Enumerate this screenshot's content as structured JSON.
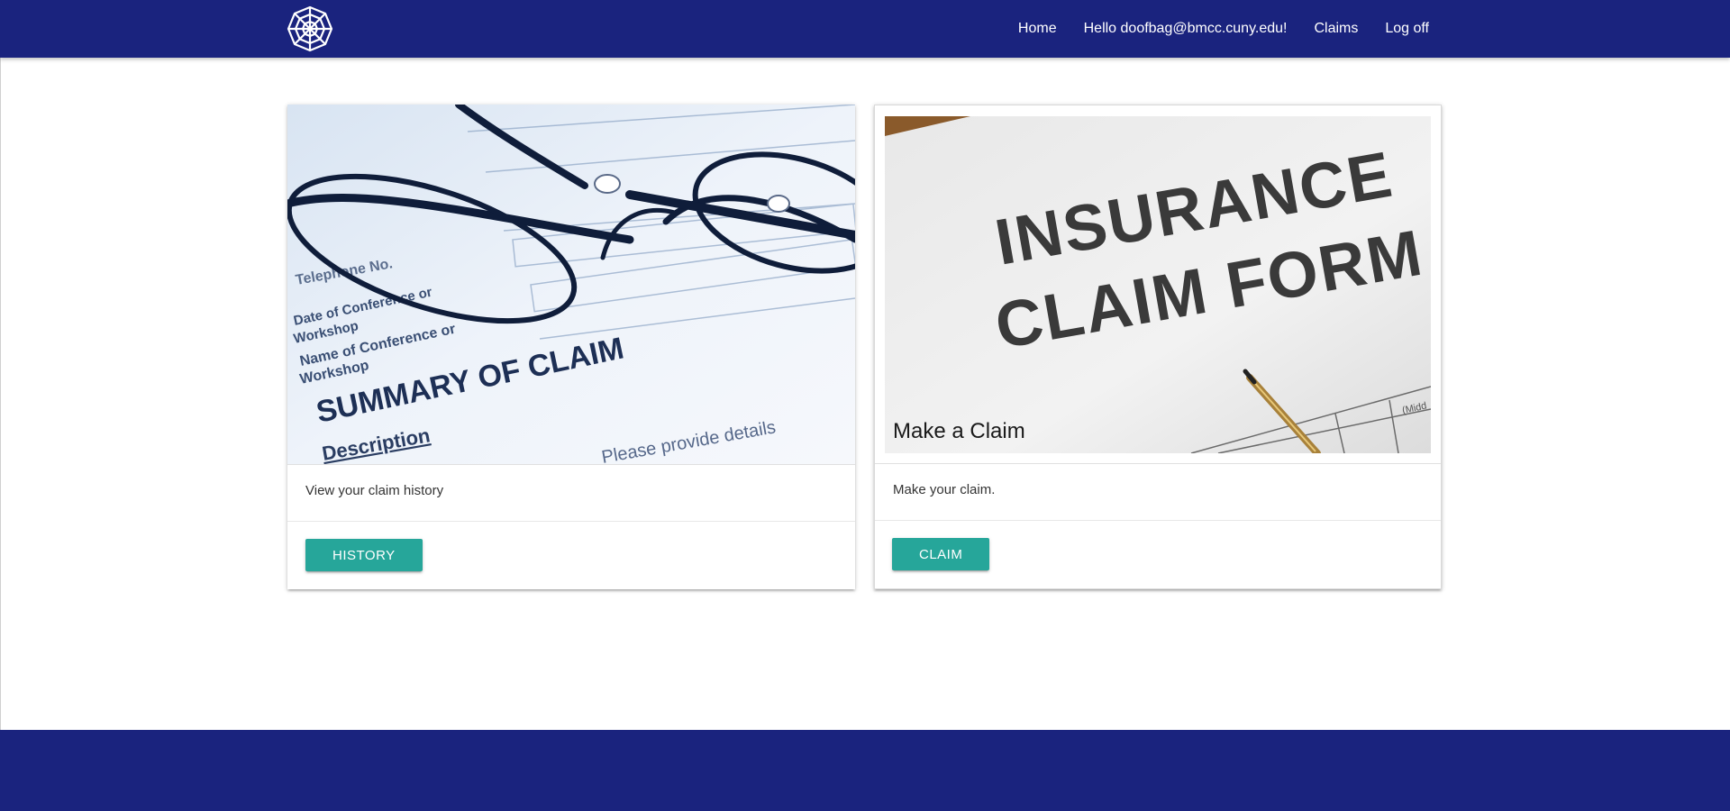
{
  "nav": {
    "logo_icon": "spider-web-icon",
    "links": [
      {
        "label": "Home"
      },
      {
        "label": "Hello doofbag@bmcc.cuny.edu!"
      },
      {
        "label": "Claims"
      },
      {
        "label": "Log off"
      }
    ]
  },
  "cards": [
    {
      "image_alt": "Summary of claim document with eyeglasses",
      "image_title": "",
      "description": "View your claim history",
      "button_label": "HISTORY"
    },
    {
      "image_alt": "Insurance claim form with pen",
      "image_title": "Make a Claim",
      "description": "Make your claim.",
      "button_label": "CLAIM"
    }
  ],
  "colors": {
    "navbar": "#1a237e",
    "footer": "#1a237e",
    "button": "#26a69a"
  }
}
